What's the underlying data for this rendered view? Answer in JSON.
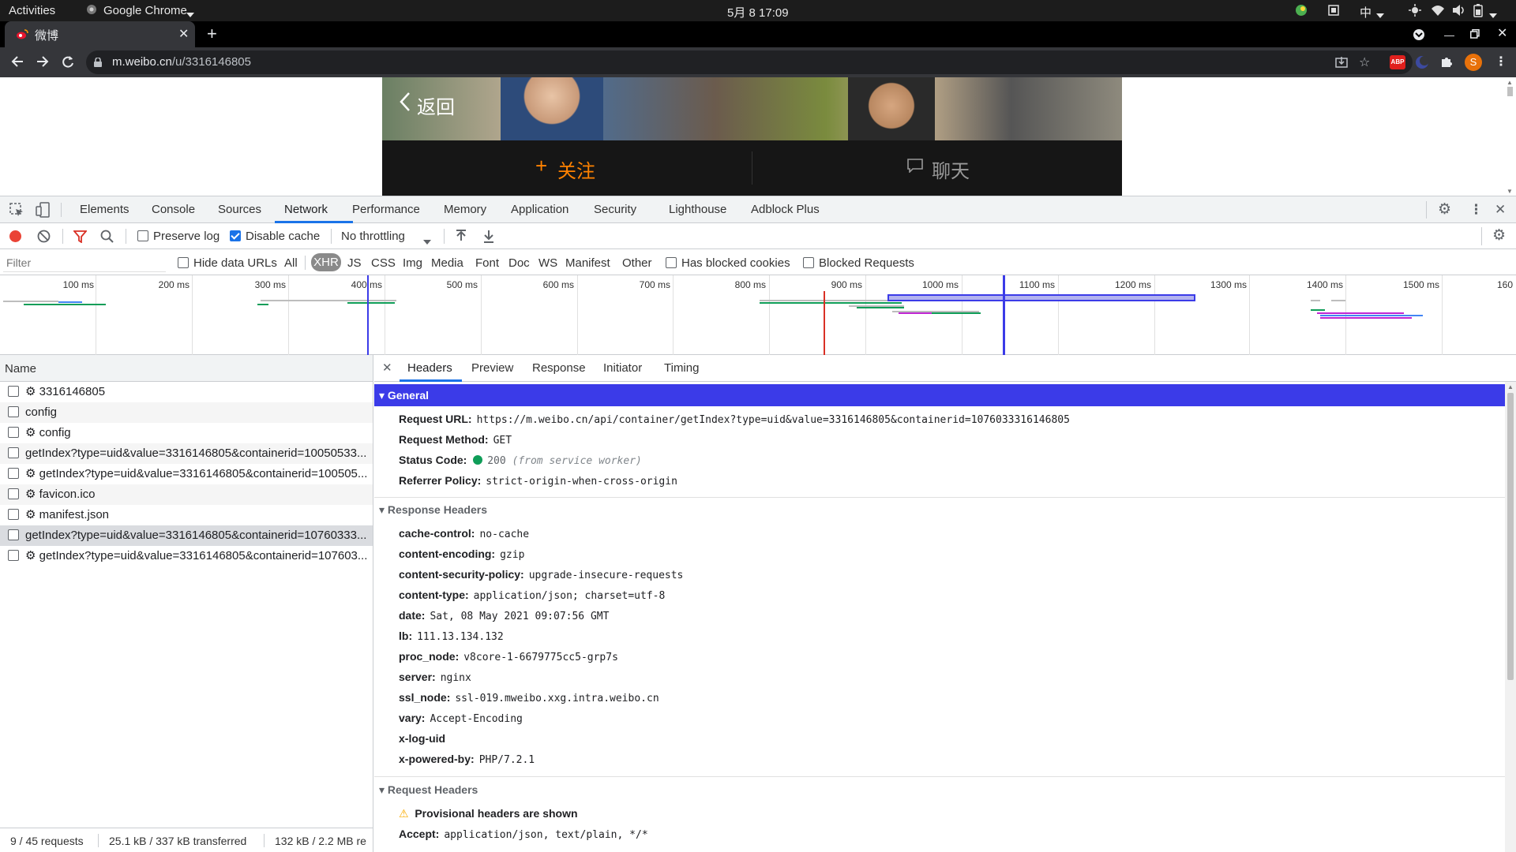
{
  "system_bar": {
    "activities": "Activities",
    "app_name": "Google Chrome",
    "clock": "5月 8  17:09",
    "ime": "中"
  },
  "browser": {
    "tab_title": "微博",
    "url_host": "m.weibo.cn",
    "url_path": "/u/3316146805",
    "profile_initial": "S",
    "abp_badge": "ABP"
  },
  "page": {
    "back_label": "返回",
    "follow_label": "关注",
    "chat_label": "聊天"
  },
  "devtools": {
    "tabs": [
      "Elements",
      "Console",
      "Sources",
      "Network",
      "Performance",
      "Memory",
      "Application",
      "Security",
      "Lighthouse",
      "Adblock Plus"
    ],
    "active_tab": "Network",
    "toolbar": {
      "preserve_log": "Preserve log",
      "disable_cache": "Disable cache",
      "throttling": "No throttling"
    },
    "filter": {
      "placeholder": "Filter",
      "hide_data_urls": "Hide data URLs",
      "types": [
        "All",
        "XHR",
        "JS",
        "CSS",
        "Img",
        "Media",
        "Font",
        "Doc",
        "WS",
        "Manifest",
        "Other"
      ],
      "active_type": "XHR",
      "has_blocked_cookies": "Has blocked cookies",
      "blocked_requests": "Blocked Requests"
    },
    "timeline_ticks": [
      "100 ms",
      "200 ms",
      "300 ms",
      "400 ms",
      "500 ms",
      "600 ms",
      "700 ms",
      "800 ms",
      "900 ms",
      "1000 ms",
      "1100 ms",
      "1200 ms",
      "1300 ms",
      "1400 ms",
      "1500 ms",
      "160"
    ],
    "requests_header": "Name",
    "requests": [
      {
        "name": "3316146805",
        "sw": true
      },
      {
        "name": "config",
        "sw": false
      },
      {
        "name": "config",
        "sw": true
      },
      {
        "name": "getIndex?type=uid&value=3316146805&containerid=10050533...",
        "sw": false
      },
      {
        "name": "getIndex?type=uid&value=3316146805&containerid=100505...",
        "sw": true
      },
      {
        "name": "favicon.ico",
        "sw": true
      },
      {
        "name": "manifest.json",
        "sw": true
      },
      {
        "name": "getIndex?type=uid&value=3316146805&containerid=10760333...",
        "sw": false
      },
      {
        "name": "getIndex?type=uid&value=3316146805&containerid=107603...",
        "sw": true
      }
    ],
    "status_bar": {
      "requests": "9 / 45 requests",
      "transferred": "25.1 kB / 337 kB transferred",
      "resources": "132 kB / 2.2 MB re"
    },
    "detail_tabs": [
      "Headers",
      "Preview",
      "Response",
      "Initiator",
      "Timing"
    ],
    "active_detail_tab": "Headers",
    "general": {
      "title": "General",
      "request_url_label": "Request URL:",
      "request_url": "https://m.weibo.cn/api/container/getIndex?type=uid&value=3316146805&containerid=1076033316146805",
      "method_label": "Request Method:",
      "method": "GET",
      "status_label": "Status Code:",
      "status_code": "200",
      "status_note": "(from service worker)",
      "referrer_label": "Referrer Policy:",
      "referrer": "strict-origin-when-cross-origin"
    },
    "response_headers": {
      "title": "Response Headers",
      "items": [
        {
          "k": "cache-control:",
          "v": "no-cache"
        },
        {
          "k": "content-encoding:",
          "v": "gzip"
        },
        {
          "k": "content-security-policy:",
          "v": "upgrade-insecure-requests"
        },
        {
          "k": "content-type:",
          "v": "application/json; charset=utf-8"
        },
        {
          "k": "date:",
          "v": "Sat, 08 May 2021 09:07:56 GMT"
        },
        {
          "k": "lb:",
          "v": "111.13.134.132"
        },
        {
          "k": "proc_node:",
          "v": "v8core-1-6679775cc5-grp7s"
        },
        {
          "k": "server:",
          "v": "nginx"
        },
        {
          "k": "ssl_node:",
          "v": "ssl-019.mweibo.xxg.intra.weibo.cn"
        },
        {
          "k": "vary:",
          "v": "Accept-Encoding"
        },
        {
          "k": "x-log-uid",
          "v": ""
        },
        {
          "k": "x-powered-by:",
          "v": "PHP/7.2.1"
        }
      ]
    },
    "request_headers": {
      "title": "Request Headers",
      "warning": "Provisional headers are shown",
      "accept_label": "Accept:",
      "accept": "application/json, text/plain, */*"
    }
  },
  "colors": {
    "selected_section": "#3b3be8",
    "record": "#ea4335",
    "status_ok": "#0f9d58",
    "follow_orange": "#ff8200"
  }
}
